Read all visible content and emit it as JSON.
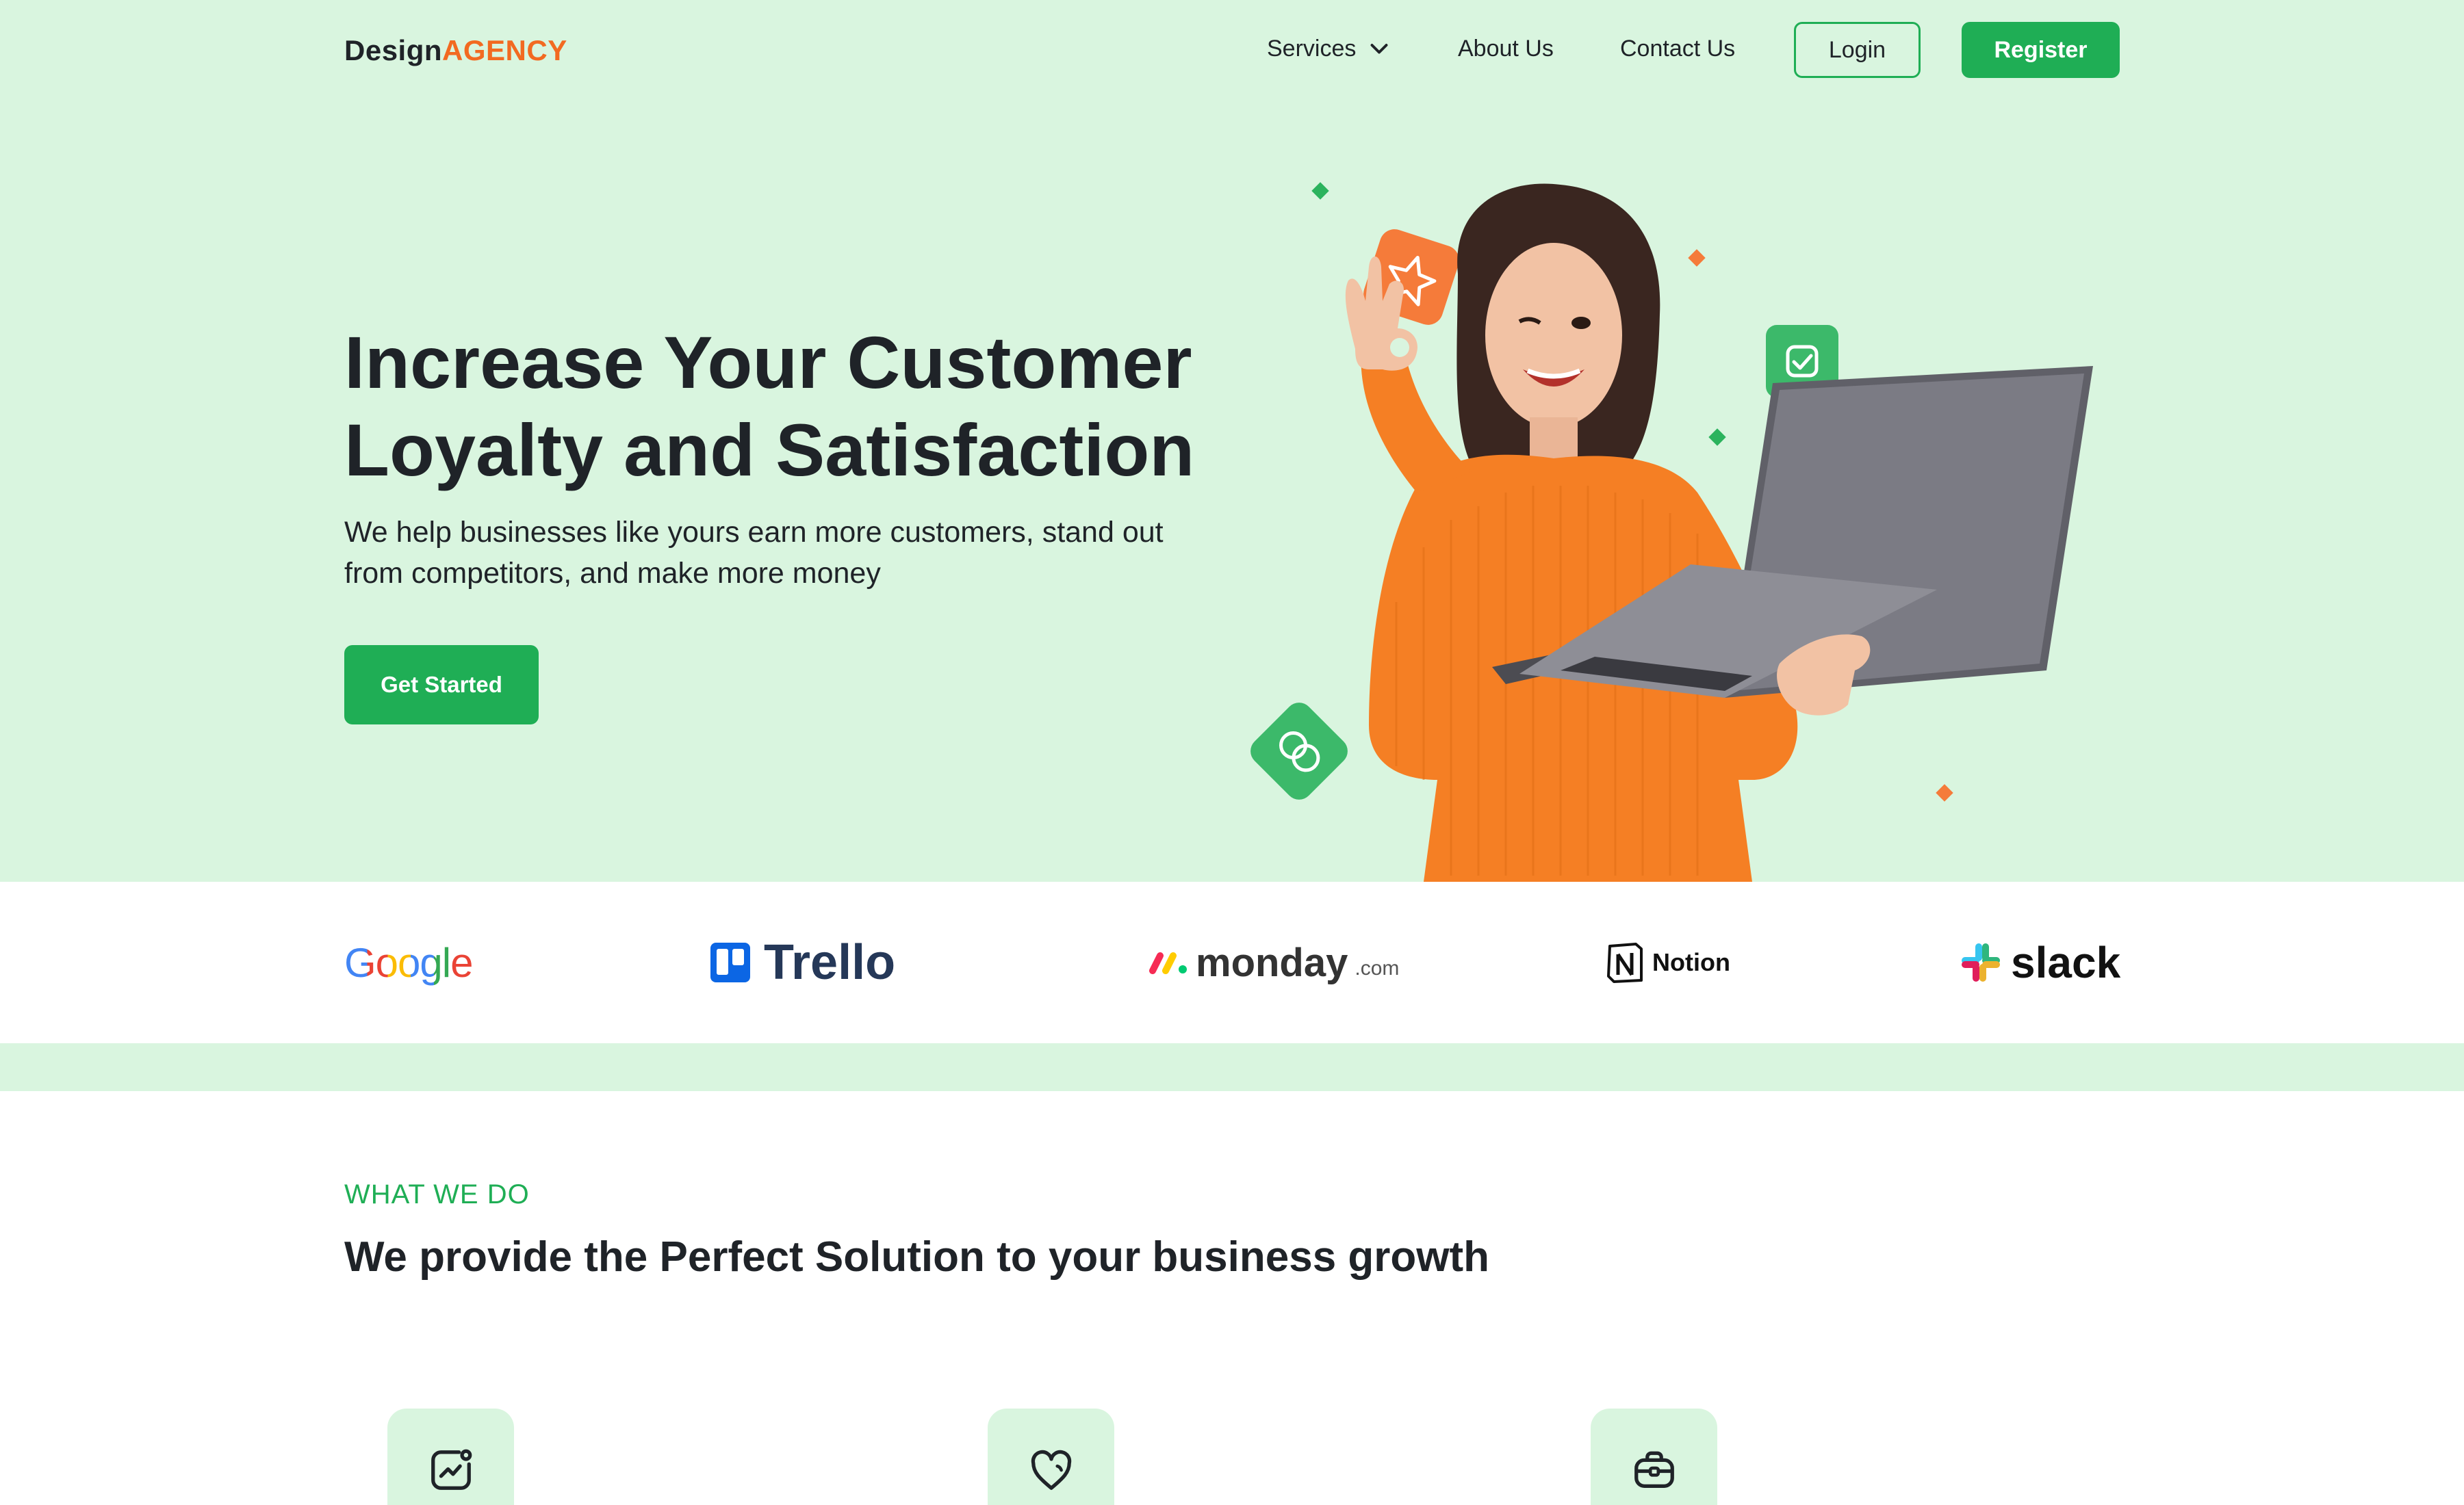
{
  "nav": {
    "logo_part1": "Design",
    "logo_part2": "AGENCY",
    "services": "Services",
    "about": "About Us",
    "contact": "Contact Us",
    "login": "Login",
    "register": "Register"
  },
  "hero": {
    "title_line1": "Increase Your Customer",
    "title_line2": "Loyalty and Satisfaction",
    "subtitle_line1": "We help businesses like yours earn more customers, stand out",
    "subtitle_line2": "from competitors, and make more money",
    "cta": "Get Started"
  },
  "brands": {
    "google": "Google",
    "trello": "Trello",
    "monday": "monday",
    "monday_suffix": ".com",
    "notion": "Notion",
    "slack": "slack"
  },
  "services": {
    "eyebrow": "WHAT WE DO",
    "title": "We provide the Perfect Solution to your business growth",
    "icons": [
      "chart-icon",
      "heart-icon",
      "briefcase-icon"
    ]
  },
  "colors": {
    "accent": "#1fae55",
    "brand_orange": "#f26a21",
    "hero_bg": "#d9f5df",
    "text": "#1f2328"
  }
}
